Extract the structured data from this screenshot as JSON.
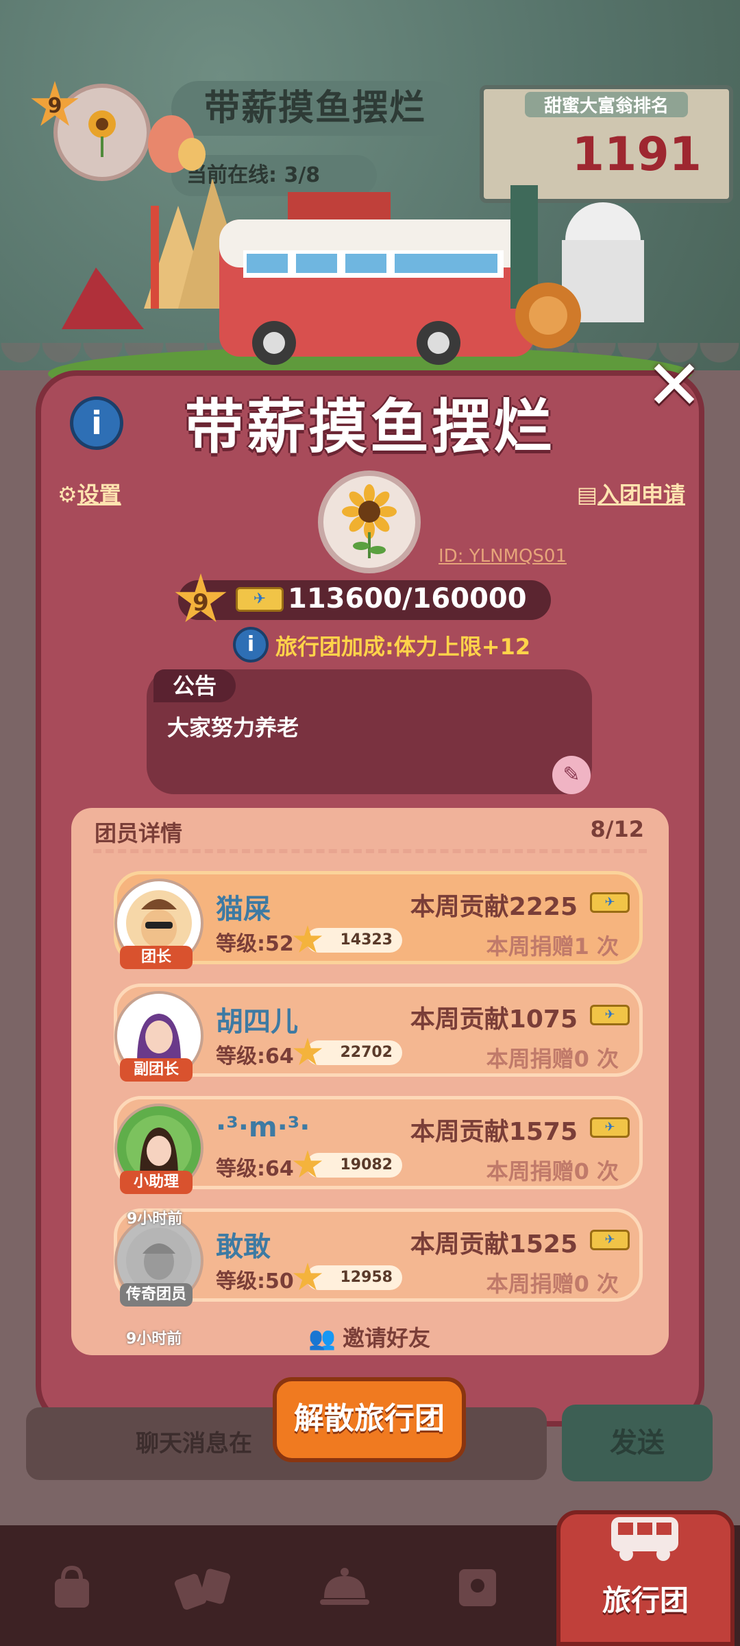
{
  "header": {
    "club_level": "9",
    "club_name": "带薪摸鱼摆烂",
    "online_label": "当前在线:",
    "online_value": "3/8",
    "rank_label": "甜蜜大富翁排名",
    "rank_value": "1191"
  },
  "modal": {
    "title": "带薪摸鱼摆烂",
    "info_label": "i",
    "close_label": "✕",
    "settings_label": "设置",
    "apply_label": "入团申请",
    "club_id": "ID: YLNMQS01",
    "level": "9",
    "exp_text": "113600/160000",
    "exp_progress": 0.71,
    "bonus_text": "旅行团加成:体力上限+12",
    "notice_label": "公告",
    "notice_text": "大家努力养老",
    "members_title": "团员详情",
    "members_count": "8/12",
    "members": [
      {
        "name": "猫屎",
        "role": "团长",
        "level": "等级:52",
        "score": "14323",
        "contrib": "本周贡献2225",
        "donate": "本周捐赠1 次",
        "time": ""
      },
      {
        "name": "胡四儿",
        "role": "副团长",
        "level": "等级:64",
        "score": "22702",
        "contrib": "本周贡献1075",
        "donate": "本周捐赠0 次",
        "time": ""
      },
      {
        "name": "·³·m·³·",
        "role": "小助理",
        "level": "等级:64",
        "score": "19082",
        "contrib": "本周贡献1575",
        "donate": "本周捐赠0 次",
        "time": ""
      },
      {
        "name": "敢敢",
        "role": "传奇团员",
        "level": "等级:50",
        "score": "12958",
        "contrib": "本周贡献1525",
        "donate": "本周捐赠0 次",
        "time": "9小时前"
      }
    ],
    "partial_time": "9小时前",
    "invite_label": "邀请好友",
    "disband_label": "解散旅行团"
  },
  "chat": {
    "placeholder": "聊天消息在",
    "send_label": "发送"
  },
  "nav": {
    "active_label": "旅行团"
  },
  "colors": {
    "modal_bg": "#a84b5a",
    "accent_yellow": "#ffd34a",
    "name_blue": "#3d7aa3",
    "disband_orange": "#f07a20"
  }
}
